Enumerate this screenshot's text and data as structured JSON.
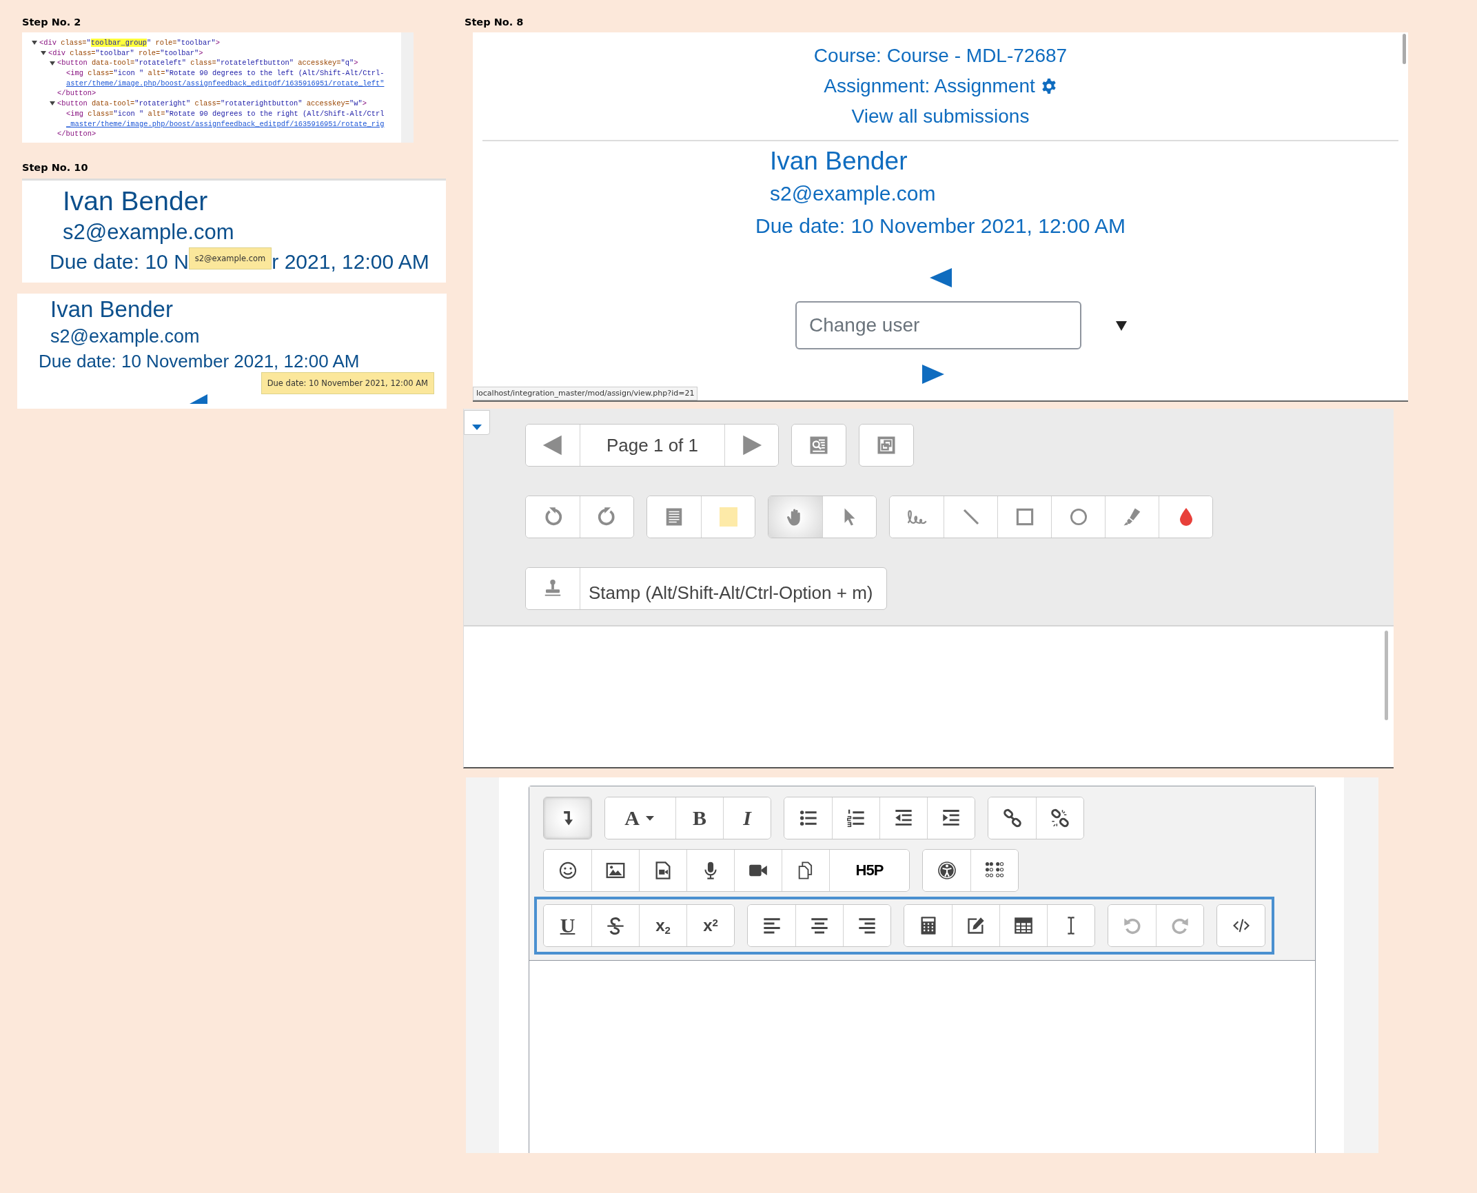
{
  "step_2": {
    "label": "Step No. 2",
    "code": [
      {
        "expanded": true,
        "parts": [
          {
            "kind": "tag",
            "t": "<div"
          },
          {
            "kind": "attr",
            "t": " class="
          },
          {
            "kind": "val",
            "t": "\""
          },
          {
            "kind": "hl",
            "t": "toolbar_group"
          },
          {
            "kind": "val",
            "t": "\""
          },
          {
            "kind": "attr",
            "t": " role="
          },
          {
            "kind": "val",
            "t": "\"toolbar\""
          },
          {
            "kind": "tag",
            "t": ">"
          }
        ],
        "children": [
          {
            "expanded": true,
            "parts": [
              {
                "kind": "tag",
                "t": "<div"
              },
              {
                "kind": "attr",
                "t": " class="
              },
              {
                "kind": "val",
                "t": "\"toolbar\""
              },
              {
                "kind": "attr",
                "t": " role="
              },
              {
                "kind": "val",
                "t": "\"toolbar\""
              },
              {
                "kind": "tag",
                "t": ">"
              }
            ],
            "children": [
              {
                "expanded": true,
                "parts": [
                  {
                    "kind": "tag",
                    "t": "<button"
                  },
                  {
                    "kind": "attr",
                    "t": " data-tool="
                  },
                  {
                    "kind": "val",
                    "t": "\"rotateleft\""
                  },
                  {
                    "kind": "attr",
                    "t": " class="
                  },
                  {
                    "kind": "val",
                    "t": "\"rotateleftbutton\""
                  },
                  {
                    "kind": "attr",
                    "t": " accesskey="
                  },
                  {
                    "kind": "val",
                    "t": "\"q\""
                  },
                  {
                    "kind": "tag",
                    "t": ">"
                  }
                ],
                "children": [
                  {
                    "parts": [
                      {
                        "kind": "tag",
                        "t": "<img"
                      },
                      {
                        "kind": "attr",
                        "t": " class="
                      },
                      {
                        "kind": "val",
                        "t": "\"icon \""
                      },
                      {
                        "kind": "attr",
                        "t": " alt="
                      },
                      {
                        "kind": "val",
                        "t": "\"Rotate 90 degrees to the left (Alt/Shift-Alt/Ctrl-"
                      }
                    ],
                    "link": "aster/theme/image.php/boost/assignfeedback_editpdf/1635916951/rotate_left\""
                  }
                ],
                "close": "</button>"
              },
              {
                "expanded": true,
                "parts": [
                  {
                    "kind": "tag",
                    "t": "<button"
                  },
                  {
                    "kind": "attr",
                    "t": " data-tool="
                  },
                  {
                    "kind": "val",
                    "t": "\"rotateright\""
                  },
                  {
                    "kind": "attr",
                    "t": " class="
                  },
                  {
                    "kind": "val",
                    "t": "\"rotaterightbutton\""
                  },
                  {
                    "kind": "attr",
                    "t": " accesskey="
                  },
                  {
                    "kind": "val",
                    "t": "\"w\""
                  },
                  {
                    "kind": "tag",
                    "t": ">"
                  }
                ],
                "children": [
                  {
                    "parts": [
                      {
                        "kind": "tag",
                        "t": "<img"
                      },
                      {
                        "kind": "attr",
                        "t": " class="
                      },
                      {
                        "kind": "val",
                        "t": "\"icon \""
                      },
                      {
                        "kind": "attr",
                        "t": " alt="
                      },
                      {
                        "kind": "val",
                        "t": "\"Rotate 90 degrees to the right (Alt/Shift-Alt/Ctrl"
                      }
                    ],
                    "link": "_master/theme/image.php/boost/assignfeedback_editpdf/1635916951/rotate_rig"
                  }
                ],
                "close": "</button>"
              }
            ]
          }
        ]
      }
    ]
  },
  "step_10": {
    "label": "Step No. 10",
    "panels": [
      {
        "name": "Ivan Bender",
        "email": "s2@example.com",
        "due_date_parts": [
          "Due date: 10 N",
          "r 2021, 12:00 AM"
        ],
        "tooltip": "s2@example.com"
      },
      {
        "name": "Ivan Bender",
        "email": "s2@example.com",
        "due_date": "Due date: 10 November 2021, 12:00 AM",
        "tooltip": "Due date: 10 November 2021, 12:00 AM"
      }
    ]
  },
  "step_8": {
    "label": "Step No. 8",
    "course_link": "Course: Course - MDL-72687",
    "assignment_link": "Assignment: Assignment",
    "view_all_link": "View all submissions",
    "user": {
      "name": "Ivan Bender",
      "email": "s2@example.com",
      "due_date": "Due date: 10 November 2021, 12:00 AM"
    },
    "change_user": {
      "placeholder": "Change user"
    },
    "status_url": "localhost/integration_master/mod/assign/view.php?id=21"
  },
  "pdf_toolbar": {
    "expanded": true,
    "rows": [
      {
        "groups": [
          [
            {
              "kind": "prev"
            },
            {
              "kind": "page-label",
              "label": "Page 1 of 1"
            },
            {
              "kind": "next"
            }
          ],
          [
            {
              "kind": "search-comments"
            }
          ],
          [
            {
              "kind": "expand"
            }
          ]
        ]
      },
      {
        "groups": [
          [
            {
              "kind": "rotate-left",
              "selected": false
            },
            {
              "kind": "rotate-right",
              "selected": false
            }
          ],
          [
            {
              "kind": "comment",
              "selected": false
            },
            {
              "kind": "color-swatch",
              "selected": false,
              "color": "#fdeaa8"
            }
          ],
          [
            {
              "kind": "pan",
              "selected": true
            },
            {
              "kind": "select",
              "selected": false
            }
          ],
          [
            {
              "kind": "pen",
              "selected": false
            },
            {
              "kind": "line",
              "selected": false
            },
            {
              "kind": "rectangle",
              "selected": false
            },
            {
              "kind": "oval",
              "selected": false
            },
            {
              "kind": "highlighter",
              "selected": false
            },
            {
              "kind": "color-drop",
              "selected": false,
              "color": "#e8403a"
            }
          ]
        ]
      },
      {
        "groups": [
          [
            {
              "kind": "stamp"
            },
            {
              "kind": "stamp-label",
              "label": "Stamp (Alt/Shift-Alt/Ctrl-Option + m)"
            }
          ]
        ]
      }
    ]
  },
  "editor_toolbar": {
    "rows": [
      {
        "focused": false,
        "groups": [
          {
            "disabled": false,
            "buttons": [
              {
                "kind": "collapse",
                "pressed": true
              }
            ]
          },
          {
            "disabled": false,
            "buttons": [
              {
                "kind": "font",
                "glyph": "A",
                "pressed": false
              },
              {
                "kind": "bold",
                "glyph": "B",
                "pressed": false
              },
              {
                "kind": "italic",
                "glyph": "I",
                "pressed": false
              }
            ]
          },
          {
            "disabled": false,
            "buttons": [
              {
                "kind": "bullet-list",
                "pressed": false
              },
              {
                "kind": "numbered-list",
                "pressed": false
              },
              {
                "kind": "outdent",
                "pressed": false
              },
              {
                "kind": "indent",
                "pressed": false
              }
            ]
          },
          {
            "disabled": false,
            "buttons": [
              {
                "kind": "link",
                "pressed": false
              },
              {
                "kind": "unlink",
                "pressed": false
              }
            ]
          }
        ]
      },
      {
        "focused": false,
        "groups": [
          {
            "disabled": false,
            "buttons": [
              {
                "kind": "emoji",
                "pressed": false
              },
              {
                "kind": "image",
                "pressed": false
              },
              {
                "kind": "media",
                "pressed": false
              },
              {
                "kind": "audio",
                "pressed": false
              },
              {
                "kind": "video",
                "pressed": false
              },
              {
                "kind": "files",
                "pressed": false
              },
              {
                "kind": "h5p",
                "glyph": "H5P",
                "pressed": false
              }
            ]
          },
          {
            "disabled": false,
            "buttons": [
              {
                "kind": "accessibility",
                "pressed": false
              },
              {
                "kind": "screenreader",
                "pressed": false
              }
            ]
          }
        ]
      },
      {
        "focused": true,
        "groups": [
          {
            "disabled": false,
            "buttons": [
              {
                "kind": "underline",
                "glyph": "U",
                "pressed": false
              },
              {
                "kind": "strikethrough",
                "pressed": false
              },
              {
                "kind": "subscript",
                "glyph": "x$_{2}$",
                "pressed": false
              },
              {
                "kind": "superscript",
                "glyph": "x$^{2}$",
                "pressed": false
              }
            ]
          },
          {
            "disabled": false,
            "buttons": [
              {
                "kind": "align-left",
                "pressed": false
              },
              {
                "kind": "align-center",
                "pressed": false
              },
              {
                "kind": "align-right",
                "pressed": false
              }
            ]
          },
          {
            "disabled": false,
            "buttons": [
              {
                "kind": "equation",
                "pressed": false
              },
              {
                "kind": "edit",
                "pressed": false
              },
              {
                "kind": "table",
                "pressed": false
              },
              {
                "kind": "special-char",
                "pressed": false
              }
            ]
          },
          {
            "disabled": true,
            "buttons": [
              {
                "kind": "undo",
                "pressed": false
              },
              {
                "kind": "redo",
                "pressed": false
              }
            ]
          },
          {
            "disabled": false,
            "buttons": [
              {
                "kind": "html",
                "pressed": false
              }
            ]
          }
        ]
      }
    ]
  }
}
